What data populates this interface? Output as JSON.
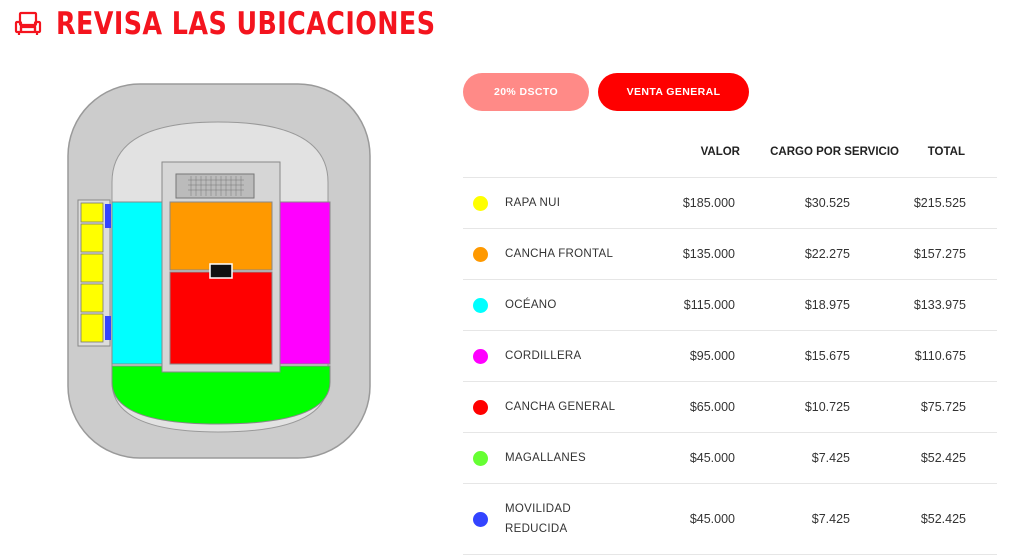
{
  "header": {
    "title": "REVISA LAS UBICACIONES",
    "icon": "armchair-icon",
    "accent": "#f4141e"
  },
  "tabs": [
    {
      "label": "20% DSCTO",
      "color": "#ff8a87"
    },
    {
      "label": "VENTA GENERAL",
      "color": "#ff0000"
    }
  ],
  "table": {
    "headers": {
      "valor": "VALOR",
      "cargo": "CARGO POR SERVICIO",
      "total": "TOTAL"
    },
    "rows": [
      {
        "name": "RAPA NUI",
        "color": "#ffff00",
        "valor": "$185.000",
        "cargo": "$30.525",
        "total": "$215.525"
      },
      {
        "name": "CANCHA FRONTAL",
        "color": "#ff9900",
        "valor": "$135.000",
        "cargo": "$22.275",
        "total": "$157.275"
      },
      {
        "name": "OCÉANO",
        "color": "#00ffff",
        "valor": "$115.000",
        "cargo": "$18.975",
        "total": "$133.975"
      },
      {
        "name": "CORDILLERA",
        "color": "#ff00ff",
        "valor": "$95.000",
        "cargo": "$15.675",
        "total": "$110.675"
      },
      {
        "name": "CANCHA GENERAL",
        "color": "#ff0000",
        "valor": "$65.000",
        "cargo": "$10.725",
        "total": "$75.725"
      },
      {
        "name": "MAGALLANES",
        "color": "#66ff33",
        "valor": "$45.000",
        "cargo": "$7.425",
        "total": "$52.425"
      },
      {
        "name": "MOVILIDAD REDUCIDA",
        "color": "#3344ff",
        "valor": "$45.000",
        "cargo": "$7.425",
        "total": "$52.425"
      }
    ]
  }
}
